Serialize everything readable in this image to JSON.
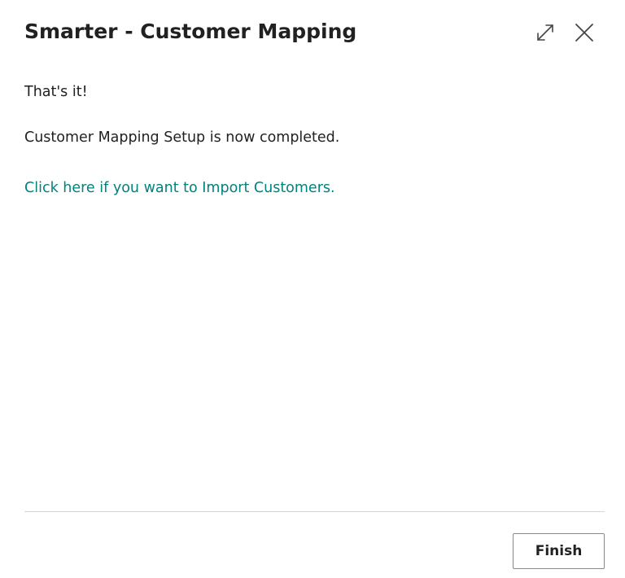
{
  "dialog": {
    "title": "Smarter - Customer Mapping",
    "intro": "That's it!",
    "completed_message": "Customer Mapping Setup is now completed.",
    "import_link": "Click here if you want to Import Customers.",
    "finish_label": "Finish"
  },
  "icons": {
    "expand": "expand-icon",
    "close": "close-icon"
  },
  "colors": {
    "link": "#00827f",
    "text": "#212121",
    "divider": "#d6d6d6"
  }
}
